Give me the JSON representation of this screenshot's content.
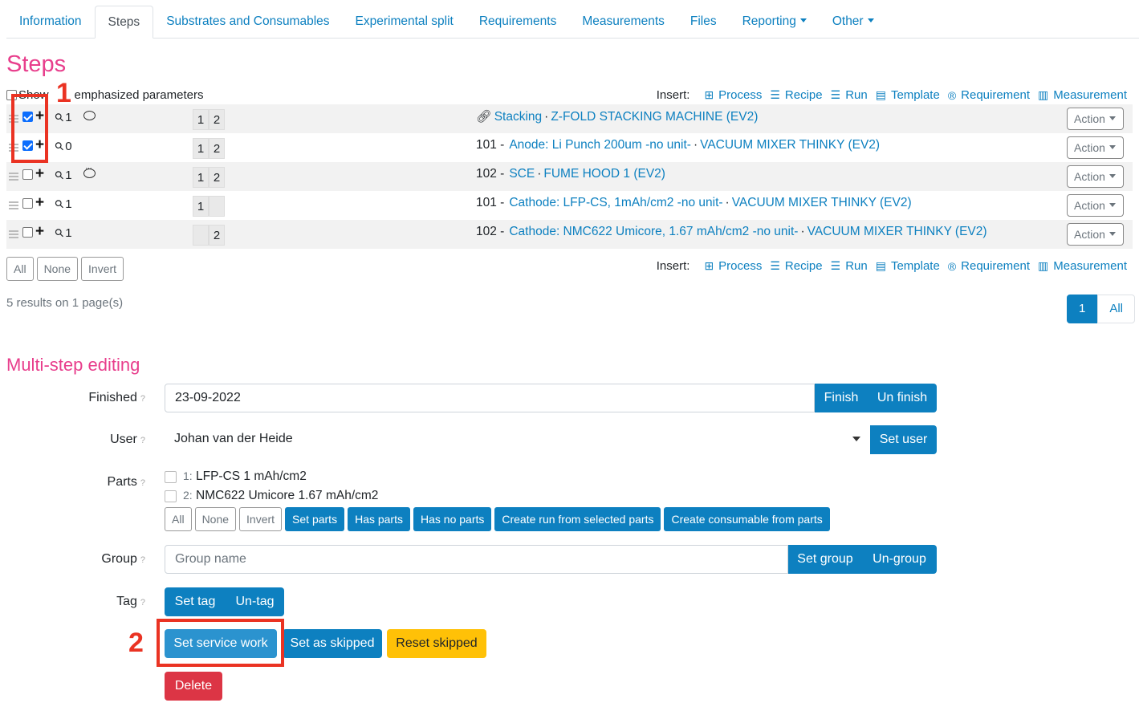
{
  "tabs": [
    {
      "label": "Information"
    },
    {
      "label": "Steps",
      "active": true
    },
    {
      "label": "Substrates and Consumables"
    },
    {
      "label": "Experimental split"
    },
    {
      "label": "Requirements"
    },
    {
      "label": "Measurements"
    },
    {
      "label": "Files"
    },
    {
      "label": "Reporting",
      "dropdown": true
    },
    {
      "label": "Other",
      "dropdown": true
    }
  ],
  "steps_section": {
    "title": "Steps",
    "show_label_part1": "Show",
    "show_label_part2": "emphasized parameters",
    "insert": {
      "label": "Insert:",
      "items": [
        {
          "label": "Process",
          "icon": "plus-square-icon"
        },
        {
          "label": "Recipe",
          "icon": "list-icon"
        },
        {
          "label": "Run",
          "icon": "list-icon"
        },
        {
          "label": "Template",
          "icon": "template-icon"
        },
        {
          "label": "Requirement",
          "icon": "registered-icon"
        },
        {
          "label": "Measurement",
          "icon": "bar-chart-icon"
        }
      ]
    },
    "rows": [
      {
        "checked": true,
        "attachments": "1",
        "comment": true,
        "parts": [
          "1",
          "2"
        ],
        "prefix": "",
        "link_icon": true,
        "step": "Stacking",
        "machine": "Z-FOLD STACKING MACHINE (EV2)",
        "action": "Action"
      },
      {
        "checked": true,
        "attachments": "0",
        "comment": false,
        "parts": [
          "1",
          "2"
        ],
        "prefix": "101 -",
        "step": "Anode: Li Punch 200um -no unit-",
        "machine": "VACUUM MIXER THINKY (EV2)",
        "action": "Action"
      },
      {
        "checked": false,
        "attachments": "1",
        "comment": true,
        "parts": [
          "1",
          "2"
        ],
        "prefix": "102 -",
        "step": "SCE",
        "machine": "FUME HOOD 1 (EV2)",
        "action": "Action"
      },
      {
        "checked": false,
        "attachments": "1",
        "comment": false,
        "parts": [
          "1",
          ""
        ],
        "prefix": "101 -",
        "step": "Cathode: LFP-CS, 1mAh/cm2 -no unit-",
        "machine": "VACUUM MIXER THINKY (EV2)",
        "action": "Action"
      },
      {
        "checked": false,
        "attachments": "1",
        "comment": false,
        "parts": [
          "",
          "2"
        ],
        "prefix": "102 -",
        "step": "Cathode: NMC622 Umicore, 1.67 mAh/cm2 -no unit-",
        "machine": "VACUUM MIXER THINKY (EV2)",
        "action": "Action"
      }
    ],
    "select_buttons": [
      "All",
      "None",
      "Invert"
    ],
    "results_text": "5 results on 1 page(s)",
    "pager": [
      "1",
      "All"
    ]
  },
  "multi": {
    "title": "Multi-step editing",
    "finished": {
      "label": "Finished",
      "value": "23-09-2022",
      "btn_finish": "Finish",
      "btn_unfinish": "Un finish"
    },
    "user": {
      "label": "User",
      "value": "Johan van der Heide",
      "btn": "Set user"
    },
    "parts": {
      "label": "Parts",
      "items": [
        {
          "num": "1:",
          "name": "LFP-CS 1 mAh/cm2"
        },
        {
          "num": "2:",
          "name": "NMC622 Umicore 1.67 mAh/cm2"
        }
      ],
      "outline_buttons": [
        "All",
        "None",
        "Invert"
      ],
      "buttons": [
        "Set parts",
        "Has parts",
        "Has no parts",
        "Create run from selected parts",
        "Create consumable from parts"
      ]
    },
    "group": {
      "label": "Group",
      "placeholder": "Group name",
      "btn_set": "Set group",
      "btn_un": "Un-group"
    },
    "tag": {
      "label": "Tag",
      "btn_set": "Set tag",
      "btn_un": "Un-tag"
    },
    "actions": {
      "service": "Set service work",
      "skipped": "Set as skipped",
      "reset": "Reset skipped",
      "delete": "Delete"
    }
  },
  "annotations": {
    "one": "1",
    "two": "2"
  },
  "colors": {
    "accent": "#0d80c0",
    "heading": "#e83e8c",
    "warning": "#ffc107",
    "danger": "#dc3545",
    "annotation": "#ea3323"
  }
}
